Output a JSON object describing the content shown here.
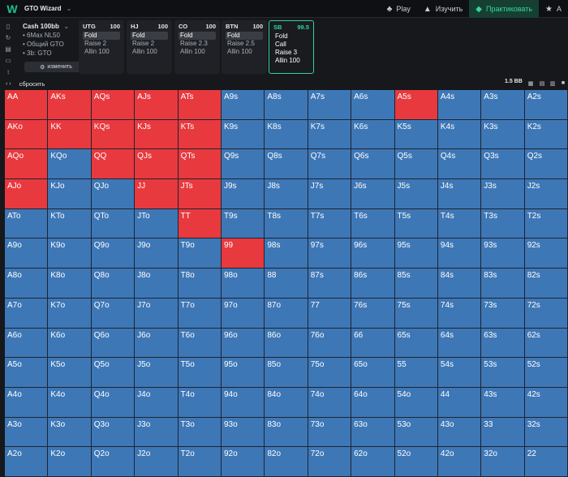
{
  "header": {
    "logo": "W",
    "app_title": "GTO Wizard",
    "nav": [
      {
        "label": "Play",
        "icon": "cards-icon",
        "glyph": "♣",
        "active": false
      },
      {
        "label": "Изучить",
        "icon": "graduation-cap-icon",
        "glyph": "▲",
        "active": false
      },
      {
        "label": "Практиковать",
        "icon": "gamepad-icon",
        "glyph": "◆",
        "active": true
      },
      {
        "label": "А",
        "icon": "trophy-icon",
        "glyph": "★",
        "active": false
      }
    ]
  },
  "config": {
    "title": "Cash 100bb",
    "lines": [
      "• 6Max NL50",
      "• Общий GTO",
      "• 3b: GTO"
    ],
    "change_label": "изменить"
  },
  "positions": [
    {
      "name": "UTG",
      "stack": "100",
      "actions": [
        "Fold",
        "Raise 2",
        "Allin 100"
      ],
      "selected": 0,
      "active": false
    },
    {
      "name": "HJ",
      "stack": "100",
      "actions": [
        "Fold",
        "Raise 2",
        "Allin 100"
      ],
      "selected": 0,
      "active": false
    },
    {
      "name": "CO",
      "stack": "100",
      "actions": [
        "Fold",
        "Raise 2.3",
        "Allin 100"
      ],
      "selected": 0,
      "active": false
    },
    {
      "name": "BTN",
      "stack": "100",
      "actions": [
        "Fold",
        "Raise 2.5",
        "Allin 100"
      ],
      "selected": 0,
      "active": false
    },
    {
      "name": "SB",
      "stack": "99.5",
      "actions": [
        "Fold",
        "Call",
        "Raise 3",
        "Allin 100"
      ],
      "selected": -1,
      "active": true
    }
  ],
  "action_bar": {
    "reset_label": "сбросить",
    "pot": "1.5 BB"
  },
  "colors": {
    "raise": "#e8393e",
    "fold": "#3e77b6",
    "accent": "#2fd39b"
  },
  "grid": {
    "rows": [
      [
        "AA",
        "AKs",
        "AQs",
        "AJs",
        "ATs",
        "A9s",
        "A8s",
        "A7s",
        "A6s",
        "A5s",
        "A4s",
        "A3s",
        "A2s"
      ],
      [
        "AKo",
        "KK",
        "KQs",
        "KJs",
        "KTs",
        "K9s",
        "K8s",
        "K7s",
        "K6s",
        "K5s",
        "K4s",
        "K3s",
        "K2s"
      ],
      [
        "AQo",
        "KQo",
        "QQ",
        "QJs",
        "QTs",
        "Q9s",
        "Q8s",
        "Q7s",
        "Q6s",
        "Q5s",
        "Q4s",
        "Q3s",
        "Q2s"
      ],
      [
        "AJo",
        "KJo",
        "QJo",
        "JJ",
        "JTs",
        "J9s",
        "J8s",
        "J7s",
        "J6s",
        "J5s",
        "J4s",
        "J3s",
        "J2s"
      ],
      [
        "ATo",
        "KTo",
        "QTo",
        "JTo",
        "TT",
        "T9s",
        "T8s",
        "T7s",
        "T6s",
        "T5s",
        "T4s",
        "T3s",
        "T2s"
      ],
      [
        "A9o",
        "K9o",
        "Q9o",
        "J9o",
        "T9o",
        "99",
        "98s",
        "97s",
        "96s",
        "95s",
        "94s",
        "93s",
        "92s"
      ],
      [
        "A8o",
        "K8o",
        "Q8o",
        "J8o",
        "T8o",
        "98o",
        "88",
        "87s",
        "86s",
        "85s",
        "84s",
        "83s",
        "82s"
      ],
      [
        "A7o",
        "K7o",
        "Q7o",
        "J7o",
        "T7o",
        "97o",
        "87o",
        "77",
        "76s",
        "75s",
        "74s",
        "73s",
        "72s"
      ],
      [
        "A6o",
        "K6o",
        "Q6o",
        "J6o",
        "T6o",
        "96o",
        "86o",
        "76o",
        "66",
        "65s",
        "64s",
        "63s",
        "62s"
      ],
      [
        "A5o",
        "K5o",
        "Q5o",
        "J5o",
        "T5o",
        "95o",
        "85o",
        "75o",
        "65o",
        "55",
        "54s",
        "53s",
        "52s"
      ],
      [
        "A4o",
        "K4o",
        "Q4o",
        "J4o",
        "T4o",
        "94o",
        "84o",
        "74o",
        "64o",
        "54o",
        "44",
        "43s",
        "42s"
      ],
      [
        "A3o",
        "K3o",
        "Q3o",
        "J3o",
        "T3o",
        "93o",
        "83o",
        "73o",
        "63o",
        "53o",
        "43o",
        "33",
        "32s"
      ],
      [
        "A2o",
        "K2o",
        "Q2o",
        "J2o",
        "T2o",
        "92o",
        "82o",
        "72o",
        "62o",
        "52o",
        "42o",
        "32o",
        "22"
      ]
    ],
    "raise_hands": [
      "AA",
      "AKs",
      "AQs",
      "AJs",
      "ATs",
      "A5s",
      "AKo",
      "KK",
      "KQs",
      "KJs",
      "KTs",
      "AQo",
      "QQ",
      "QJs",
      "QTs",
      "AJo",
      "JJ",
      "JTs",
      "TT",
      "99"
    ]
  }
}
